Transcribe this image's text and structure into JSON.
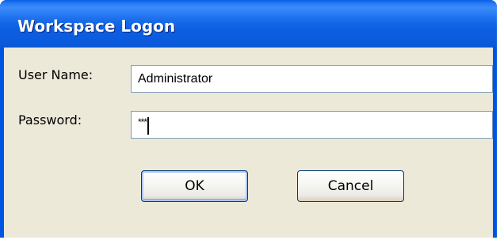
{
  "window": {
    "title": "Workspace Logon"
  },
  "form": {
    "username_label": "User Name:",
    "username_value": "Administrator",
    "password_label": "Password:",
    "password_value": "***"
  },
  "buttons": {
    "ok_label": "OK",
    "cancel_label": "Cancel"
  },
  "colors": {
    "titlebar": "#0a5fe8",
    "client_background": "#ece9d8",
    "input_border": "#7f9db9"
  }
}
